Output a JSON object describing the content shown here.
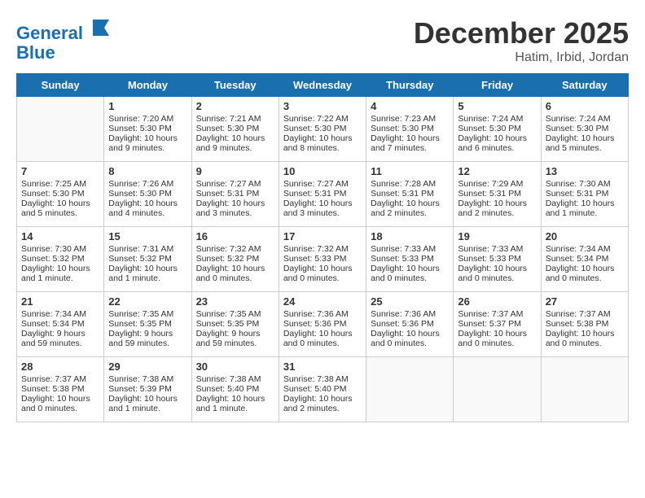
{
  "header": {
    "logo_line1": "General",
    "logo_line2": "Blue",
    "month": "December 2025",
    "location": "Hatim, Irbid, Jordan"
  },
  "weekdays": [
    "Sunday",
    "Monday",
    "Tuesday",
    "Wednesday",
    "Thursday",
    "Friday",
    "Saturday"
  ],
  "weeks": [
    [
      {
        "day": "",
        "info": ""
      },
      {
        "day": "1",
        "info": "Sunrise: 7:20 AM\nSunset: 5:30 PM\nDaylight: 10 hours\nand 9 minutes."
      },
      {
        "day": "2",
        "info": "Sunrise: 7:21 AM\nSunset: 5:30 PM\nDaylight: 10 hours\nand 9 minutes."
      },
      {
        "day": "3",
        "info": "Sunrise: 7:22 AM\nSunset: 5:30 PM\nDaylight: 10 hours\nand 8 minutes."
      },
      {
        "day": "4",
        "info": "Sunrise: 7:23 AM\nSunset: 5:30 PM\nDaylight: 10 hours\nand 7 minutes."
      },
      {
        "day": "5",
        "info": "Sunrise: 7:24 AM\nSunset: 5:30 PM\nDaylight: 10 hours\nand 6 minutes."
      },
      {
        "day": "6",
        "info": "Sunrise: 7:24 AM\nSunset: 5:30 PM\nDaylight: 10 hours\nand 5 minutes."
      }
    ],
    [
      {
        "day": "7",
        "info": "Sunrise: 7:25 AM\nSunset: 5:30 PM\nDaylight: 10 hours\nand 5 minutes."
      },
      {
        "day": "8",
        "info": "Sunrise: 7:26 AM\nSunset: 5:30 PM\nDaylight: 10 hours\nand 4 minutes."
      },
      {
        "day": "9",
        "info": "Sunrise: 7:27 AM\nSunset: 5:31 PM\nDaylight: 10 hours\nand 3 minutes."
      },
      {
        "day": "10",
        "info": "Sunrise: 7:27 AM\nSunset: 5:31 PM\nDaylight: 10 hours\nand 3 minutes."
      },
      {
        "day": "11",
        "info": "Sunrise: 7:28 AM\nSunset: 5:31 PM\nDaylight: 10 hours\nand 2 minutes."
      },
      {
        "day": "12",
        "info": "Sunrise: 7:29 AM\nSunset: 5:31 PM\nDaylight: 10 hours\nand 2 minutes."
      },
      {
        "day": "13",
        "info": "Sunrise: 7:30 AM\nSunset: 5:31 PM\nDaylight: 10 hours\nand 1 minute."
      }
    ],
    [
      {
        "day": "14",
        "info": "Sunrise: 7:30 AM\nSunset: 5:32 PM\nDaylight: 10 hours\nand 1 minute."
      },
      {
        "day": "15",
        "info": "Sunrise: 7:31 AM\nSunset: 5:32 PM\nDaylight: 10 hours\nand 1 minute."
      },
      {
        "day": "16",
        "info": "Sunrise: 7:32 AM\nSunset: 5:32 PM\nDaylight: 10 hours\nand 0 minutes."
      },
      {
        "day": "17",
        "info": "Sunrise: 7:32 AM\nSunset: 5:33 PM\nDaylight: 10 hours\nand 0 minutes."
      },
      {
        "day": "18",
        "info": "Sunrise: 7:33 AM\nSunset: 5:33 PM\nDaylight: 10 hours\nand 0 minutes."
      },
      {
        "day": "19",
        "info": "Sunrise: 7:33 AM\nSunset: 5:33 PM\nDaylight: 10 hours\nand 0 minutes."
      },
      {
        "day": "20",
        "info": "Sunrise: 7:34 AM\nSunset: 5:34 PM\nDaylight: 10 hours\nand 0 minutes."
      }
    ],
    [
      {
        "day": "21",
        "info": "Sunrise: 7:34 AM\nSunset: 5:34 PM\nDaylight: 9 hours\nand 59 minutes."
      },
      {
        "day": "22",
        "info": "Sunrise: 7:35 AM\nSunset: 5:35 PM\nDaylight: 9 hours\nand 59 minutes."
      },
      {
        "day": "23",
        "info": "Sunrise: 7:35 AM\nSunset: 5:35 PM\nDaylight: 9 hours\nand 59 minutes."
      },
      {
        "day": "24",
        "info": "Sunrise: 7:36 AM\nSunset: 5:36 PM\nDaylight: 10 hours\nand 0 minutes."
      },
      {
        "day": "25",
        "info": "Sunrise: 7:36 AM\nSunset: 5:36 PM\nDaylight: 10 hours\nand 0 minutes."
      },
      {
        "day": "26",
        "info": "Sunrise: 7:37 AM\nSunset: 5:37 PM\nDaylight: 10 hours\nand 0 minutes."
      },
      {
        "day": "27",
        "info": "Sunrise: 7:37 AM\nSunset: 5:38 PM\nDaylight: 10 hours\nand 0 minutes."
      }
    ],
    [
      {
        "day": "28",
        "info": "Sunrise: 7:37 AM\nSunset: 5:38 PM\nDaylight: 10 hours\nand 0 minutes."
      },
      {
        "day": "29",
        "info": "Sunrise: 7:38 AM\nSunset: 5:39 PM\nDaylight: 10 hours\nand 1 minute."
      },
      {
        "day": "30",
        "info": "Sunrise: 7:38 AM\nSunset: 5:40 PM\nDaylight: 10 hours\nand 1 minute."
      },
      {
        "day": "31",
        "info": "Sunrise: 7:38 AM\nSunset: 5:40 PM\nDaylight: 10 hours\nand 2 minutes."
      },
      {
        "day": "",
        "info": ""
      },
      {
        "day": "",
        "info": ""
      },
      {
        "day": "",
        "info": ""
      }
    ]
  ]
}
